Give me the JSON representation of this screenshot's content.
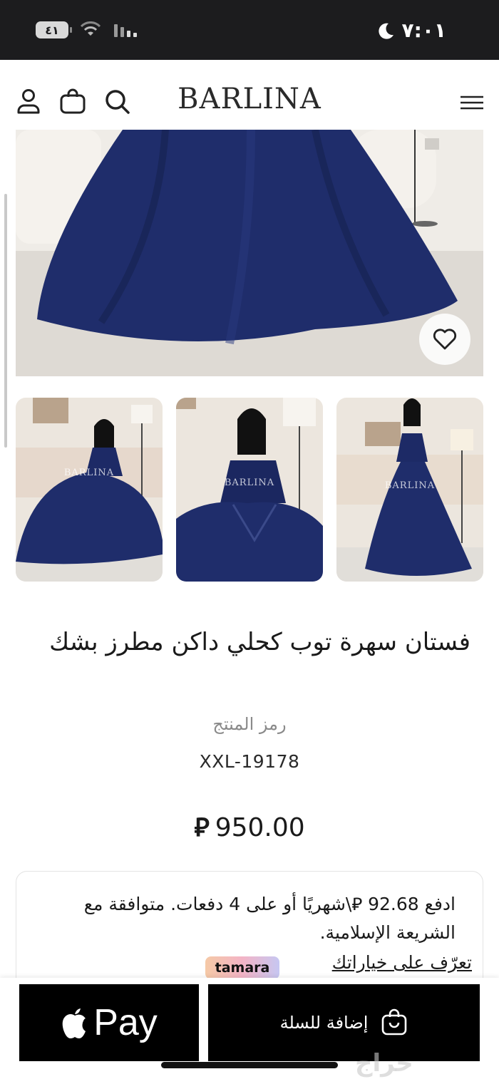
{
  "status_bar": {
    "battery": "٤١",
    "time": "٧:٠١"
  },
  "header": {
    "logo": "BARLINA",
    "icons": [
      "user-icon",
      "bag-icon",
      "search-icon",
      "menu-icon"
    ]
  },
  "gallery": {
    "watermark": "BARLINA"
  },
  "product": {
    "title": "فستان سهرة توب كحلي داكن مطرز بشك",
    "sku_label": "رمز المنتج",
    "sku_value": "XXL-19178",
    "price": "950.00",
    "currency_symbol": "⃁"
  },
  "installment": {
    "text": "ادفع 92.68 ⃁\\شهريًا أو على 4 دفعات. متوافقة مع الشريعة الإسلامية.",
    "link": "تعرّف على خياراتك",
    "provider": "tamara"
  },
  "actions": {
    "apple_pay": "Pay",
    "add_to_cart": "إضافة للسلة"
  },
  "watermark_site": "حراج",
  "colors": {
    "dress": "#1f2d6b",
    "button_bg": "#000000"
  }
}
